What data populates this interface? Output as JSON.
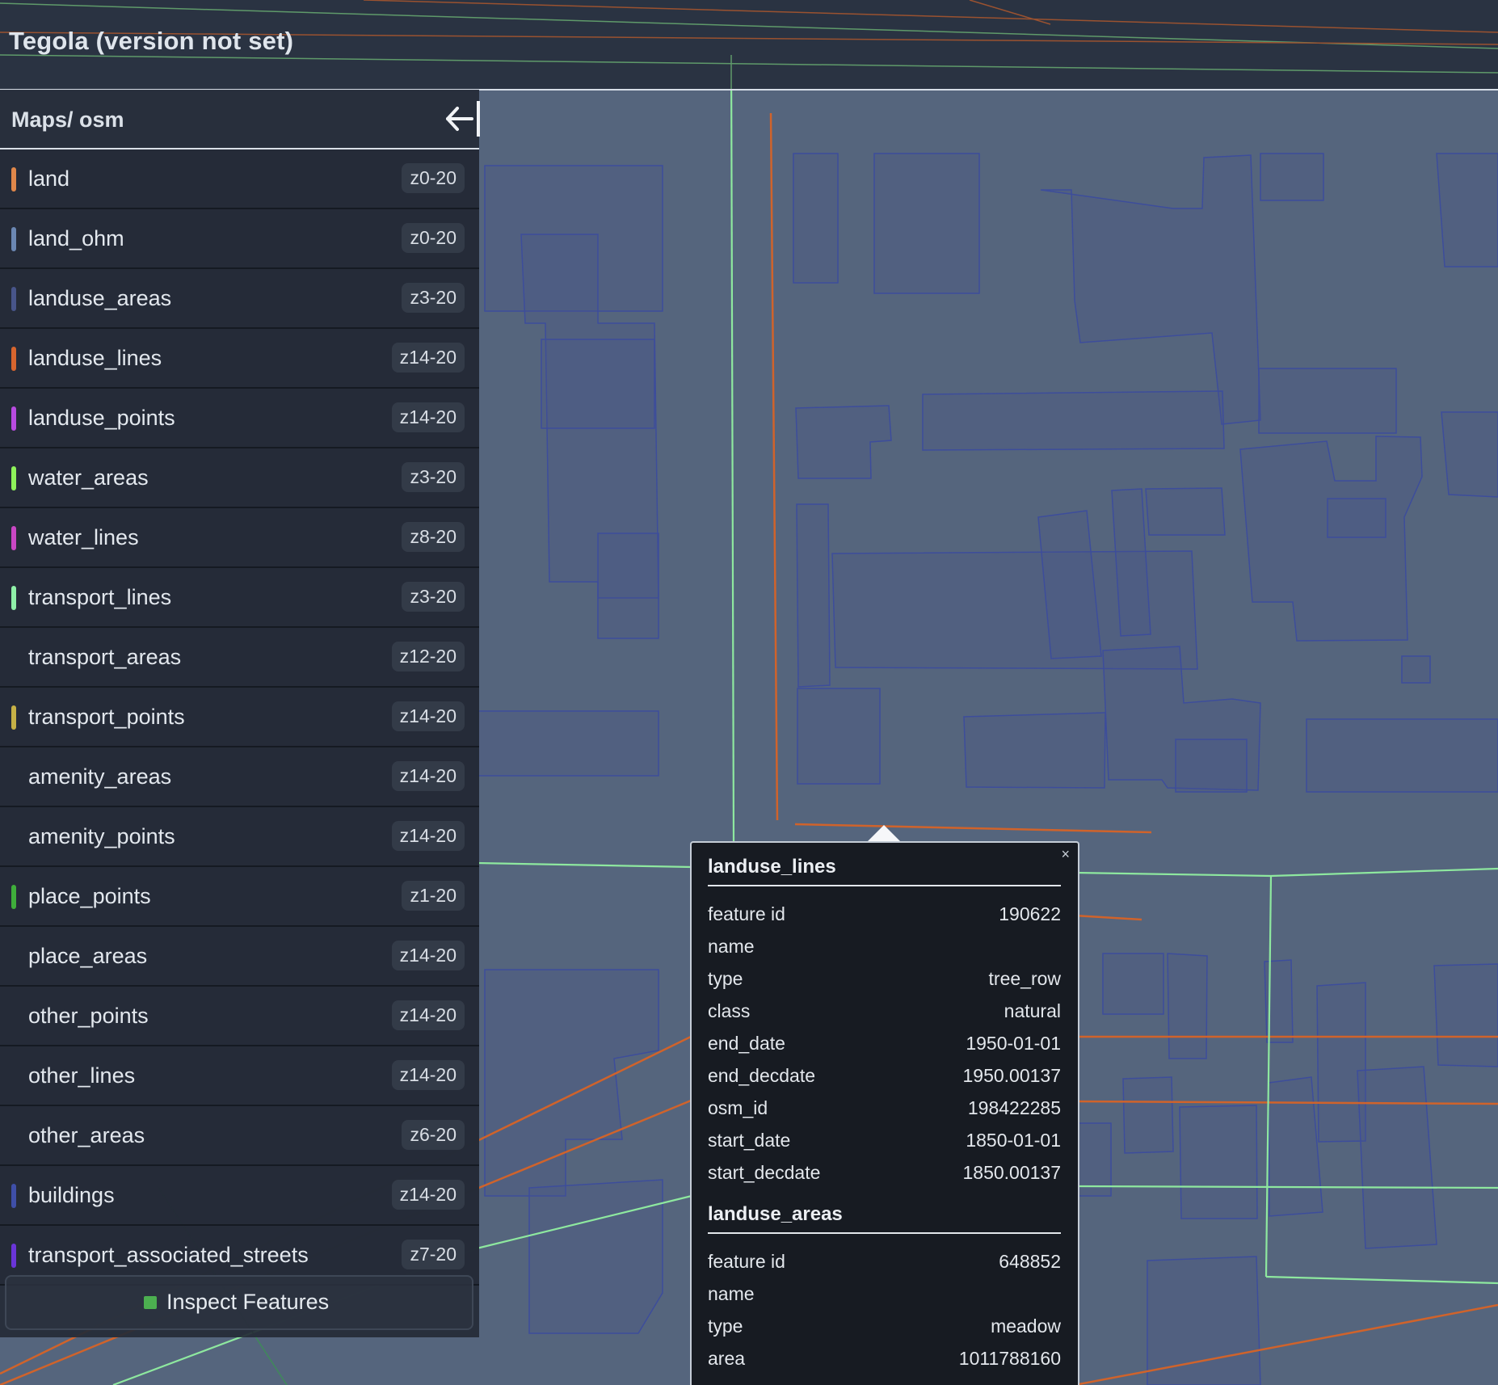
{
  "app": {
    "title": "Tegola (version not set)"
  },
  "sidebar": {
    "breadcrumb": "Maps/ osm",
    "collapse_icon": "arrow-left-icon",
    "layers": [
      {
        "name": "land",
        "zoom": "z0-20",
        "color": "#e0874a"
      },
      {
        "name": "land_ohm",
        "zoom": "z0-20",
        "color": "#6b87b3"
      },
      {
        "name": "landuse_areas",
        "zoom": "z3-20",
        "color": "#48558a"
      },
      {
        "name": "landuse_lines",
        "zoom": "z14-20",
        "color": "#d7652e"
      },
      {
        "name": "landuse_points",
        "zoom": "z14-20",
        "color": "#b84be0"
      },
      {
        "name": "water_areas",
        "zoom": "z3-20",
        "color": "#8ef25a"
      },
      {
        "name": "water_lines",
        "zoom": "z8-20",
        "color": "#c947c4"
      },
      {
        "name": "transport_lines",
        "zoom": "z3-20",
        "color": "#8ff0a8"
      },
      {
        "name": "transport_areas",
        "zoom": "z12-20",
        "color": ""
      },
      {
        "name": "transport_points",
        "zoom": "z14-20",
        "color": "#c6b146"
      },
      {
        "name": "amenity_areas",
        "zoom": "z14-20",
        "color": ""
      },
      {
        "name": "amenity_points",
        "zoom": "z14-20",
        "color": ""
      },
      {
        "name": "place_points",
        "zoom": "z1-20",
        "color": "#3fae3b"
      },
      {
        "name": "place_areas",
        "zoom": "z14-20",
        "color": ""
      },
      {
        "name": "other_points",
        "zoom": "z14-20",
        "color": ""
      },
      {
        "name": "other_lines",
        "zoom": "z14-20",
        "color": ""
      },
      {
        "name": "other_areas",
        "zoom": "z6-20",
        "color": ""
      },
      {
        "name": "buildings",
        "zoom": "z14-20",
        "color": "#3f4fa8"
      },
      {
        "name": "transport_associated_streets",
        "zoom": "z7-20",
        "color": "#6a35d8"
      }
    ],
    "inspect_label": "Inspect Features",
    "inspect_color": "#4caf50"
  },
  "popup": {
    "close_glyph": "×",
    "features": [
      {
        "layer": "landuse_lines",
        "props": [
          {
            "key": "feature id",
            "value": "190622"
          },
          {
            "key": "name",
            "value": ""
          },
          {
            "key": "type",
            "value": "tree_row"
          },
          {
            "key": "class",
            "value": "natural"
          },
          {
            "key": "end_date",
            "value": "1950-01-01"
          },
          {
            "key": "end_decdate",
            "value": "1950.00137"
          },
          {
            "key": "osm_id",
            "value": "198422285"
          },
          {
            "key": "start_date",
            "value": "1850-01-01"
          },
          {
            "key": "start_decdate",
            "value": "1850.00137"
          }
        ]
      },
      {
        "layer": "landuse_areas",
        "props": [
          {
            "key": "feature id",
            "value": "648852"
          },
          {
            "key": "name",
            "value": ""
          },
          {
            "key": "type",
            "value": "meadow"
          },
          {
            "key": "area",
            "value": "1011788160"
          }
        ]
      }
    ]
  },
  "colors": {
    "map_bg": "#55657d",
    "building_stroke": "#3d4d9b",
    "road_green": "#8ee89f",
    "landuse_orange": "#d0632b",
    "topbar_bg": "#2a3342"
  }
}
